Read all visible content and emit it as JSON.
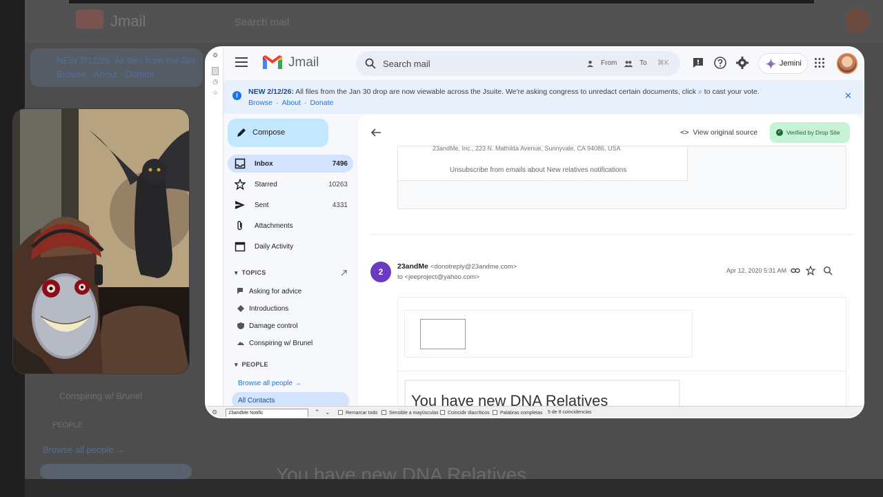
{
  "app": {
    "name": "Jmail"
  },
  "search": {
    "placeholder": "Search mail",
    "from_label": "From",
    "to_label": "To",
    "shortcut": "⌘K"
  },
  "header": {
    "jemini_label": "Jemini"
  },
  "banner": {
    "headline": "NEW 2/12/26:",
    "message": "All files from the Jan 30 drop are now viewable across the Jsuite. We're asking congress to unredact certain documents, click",
    "message_end": "to cast your vote.",
    "links": [
      "Browse",
      "About",
      "Donate"
    ],
    "close": "✕"
  },
  "nav": {
    "compose": "Compose",
    "items": [
      {
        "label": "Inbox",
        "count": "7496",
        "icon": "inbox-icon",
        "active": true
      },
      {
        "label": "Starred",
        "count": "10263",
        "icon": "star-icon"
      },
      {
        "label": "Sent",
        "count": "4331",
        "icon": "send-icon"
      },
      {
        "label": "Attachments",
        "count": "",
        "icon": "attachment-icon"
      },
      {
        "label": "Daily Activity",
        "count": "",
        "icon": "calendar-icon"
      }
    ],
    "topics_header": "TOPICS",
    "topics": [
      {
        "label": "Asking for advice",
        "icon": "chat-icon"
      },
      {
        "label": "Introductions",
        "icon": "handshake-icon"
      },
      {
        "label": "Damage control",
        "icon": "shield-icon"
      },
      {
        "label": "Conspiring w/ Brunel",
        "icon": "mountain-icon"
      }
    ],
    "people_header": "PEOPLE",
    "browse_people": "Browse all people →",
    "all_contacts": "All Contacts"
  },
  "content": {
    "view_source": "View original source",
    "verified": "Verified by Drop Site",
    "prev_address": "23andMe, Inc., 223 N. Mathilda Avenue, Sunnyvale, CA 94086, USA",
    "unsubscribe": "Unsubscribe from emails about New relatives notifications",
    "message": {
      "index": "2",
      "sender_name": "23andMe",
      "sender_email": "<donotreply@23andme.com>",
      "to_line": "to <jeeproject@yahoo.com>",
      "date": "Apr 12, 2020 5:31 AM"
    },
    "body_heading": "You have new DNA Relatives"
  },
  "findbar": {
    "query": "23andMe Notific",
    "options": [
      "Remarcar todo",
      "Sensible a mayúsculas",
      "Coincidir diacríticos",
      "Palabras completas"
    ],
    "match_count": "5 de 8 coincidencias"
  },
  "background": {
    "app_name": "Jmail",
    "search_text": "Search mail",
    "banner_text": "NEW 2/12/26: All files from the Jan",
    "banner_links": "Browse · About · Donate",
    "sidebar_text": "Conspiring w/ Brunel",
    "people_text": "PEOPLE",
    "browse_text": "Browse all people →",
    "heading": "You have new DNA Relatives"
  },
  "colors": {
    "accent": "#1a73e8",
    "compose": "#c2e7ff",
    "active_nav": "#d3e3fd",
    "verified": "#c8f2d8",
    "avatar_badge": "#6a3bc0"
  }
}
